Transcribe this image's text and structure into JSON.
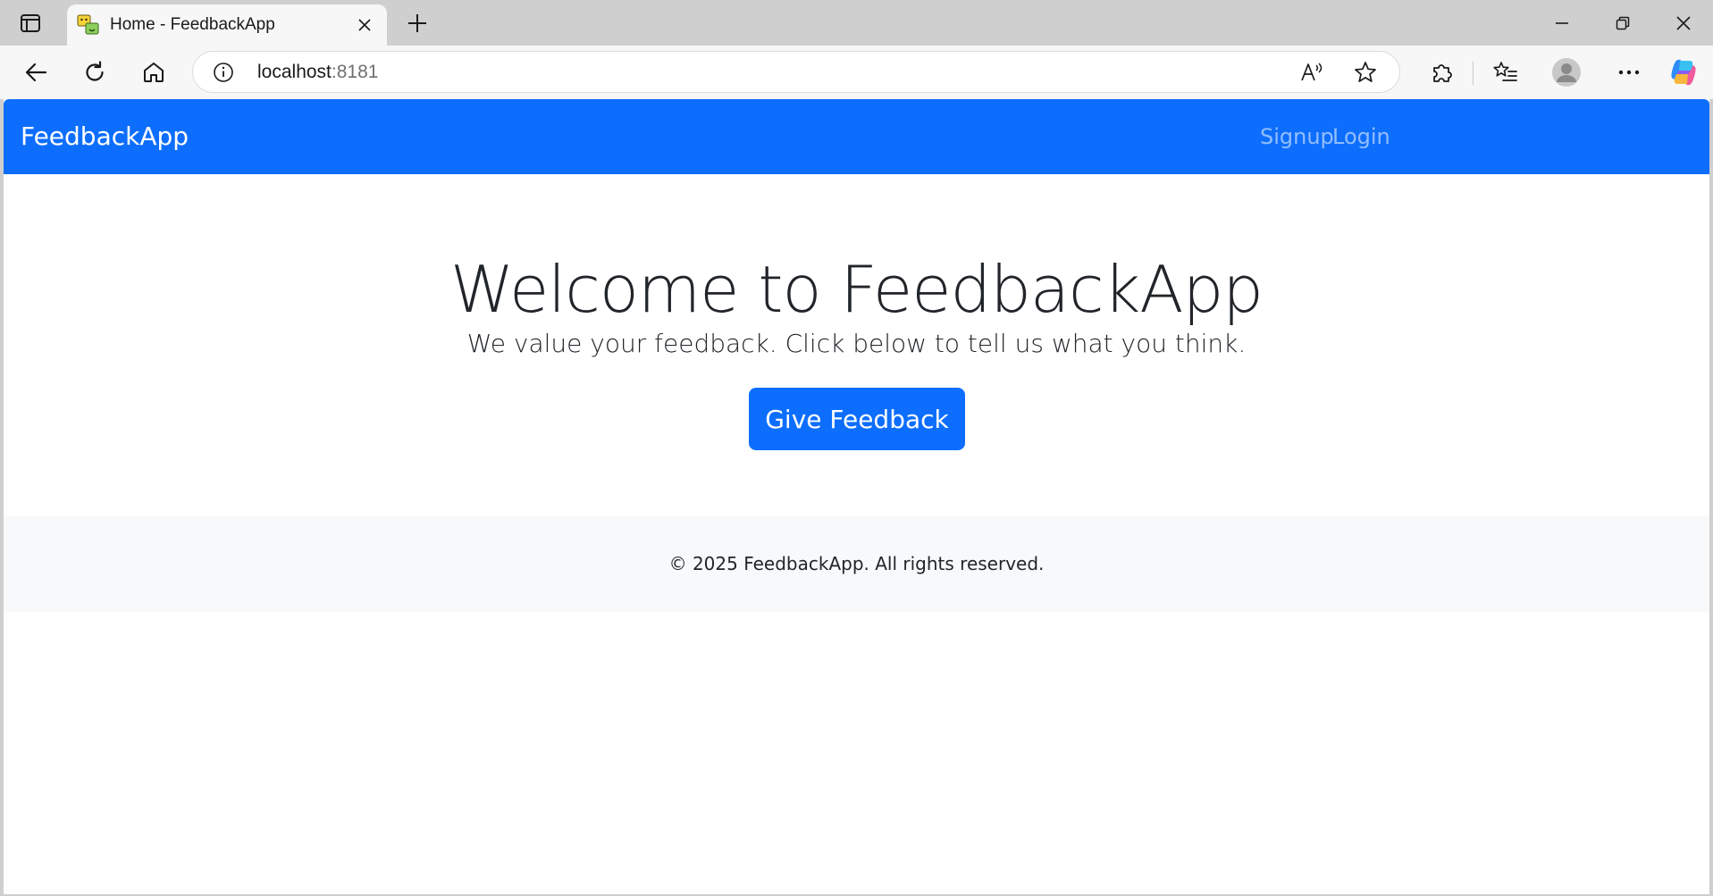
{
  "browser": {
    "tab": {
      "title": "Home - FeedbackApp"
    },
    "address": {
      "host": "localhost",
      "port": ":8181"
    },
    "icons": {
      "tab_actions": "tab-actions-icon",
      "favicon": "feedback-chat-icon",
      "tab_close": "close-icon",
      "new_tab": "plus-icon",
      "minimize": "minimize-icon",
      "restore": "restore-icon",
      "close_window": "close-icon",
      "back": "back-arrow-icon",
      "refresh": "refresh-icon",
      "home": "home-icon",
      "site_info": "info-icon",
      "read_aloud": "read-aloud-icon",
      "favorite": "star-icon",
      "extensions": "puzzle-icon",
      "favorites": "favorites-list-icon",
      "profile": "avatar-icon",
      "menu": "more-icon",
      "copilot": "copilot-icon"
    }
  },
  "page": {
    "navbar": {
      "brand": "FeedbackApp",
      "links": [
        "Signup",
        "Login"
      ]
    },
    "hero": {
      "title": "Welcome to FeedbackApp",
      "subtitle": "We value your feedback. Click below to tell us what you think.",
      "cta_label": "Give Feedback"
    },
    "footer": {
      "text": "© 2025 FeedbackApp. All rights reserved."
    },
    "colors": {
      "primary": "#0d6efd",
      "footer_bg": "#f8f9fa",
      "text": "#212529"
    }
  }
}
